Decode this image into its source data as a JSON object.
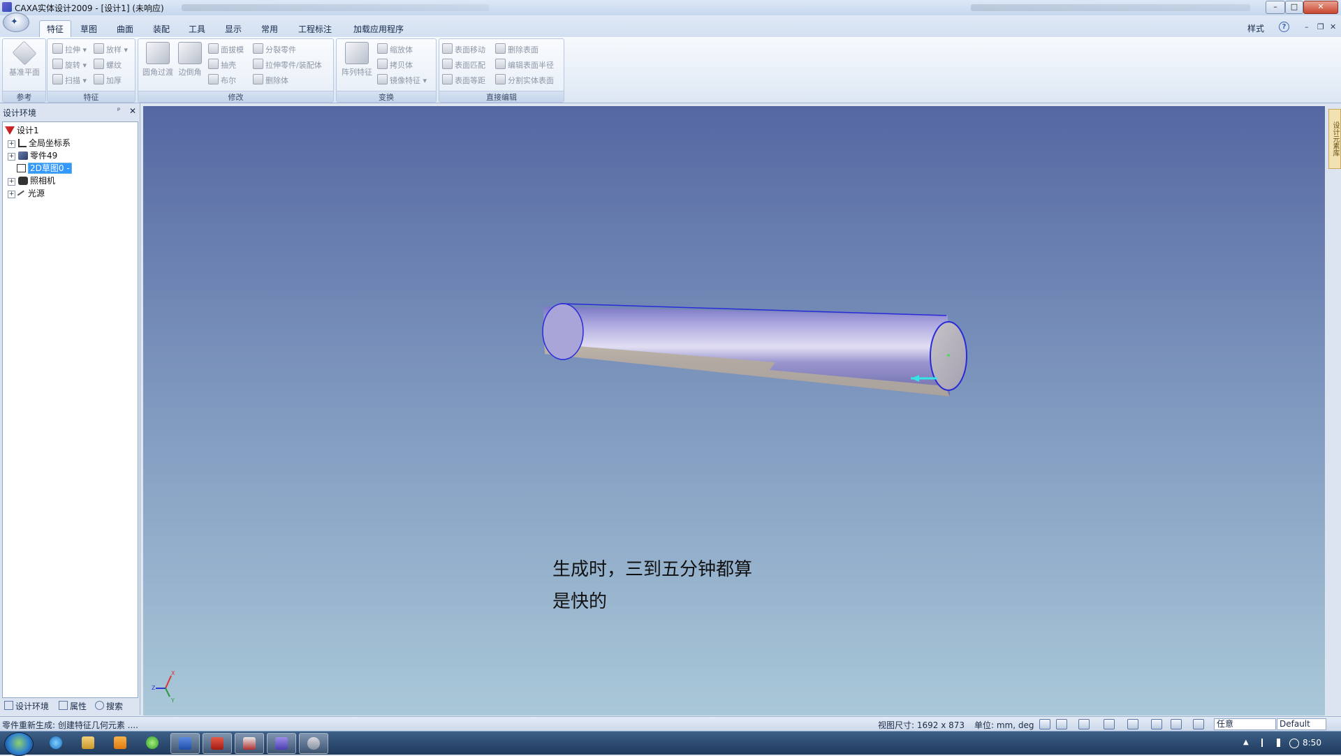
{
  "window": {
    "title": "CAXA实体设计2009 - [设计1] (未响应)",
    "minimize": "–",
    "maximize": "□",
    "close": "✕"
  },
  "ribbon": {
    "tabs": [
      "特征",
      "草图",
      "曲面",
      "装配",
      "工具",
      "显示",
      "常用",
      "工程标注",
      "加载应用程序"
    ],
    "active_tab": "特征",
    "style_label": "样式",
    "mdi_min": "–",
    "mdi_restore": "❐",
    "mdi_close": "✕",
    "groups": {
      "reference": {
        "title": "参考",
        "plane": "基准平面"
      },
      "feature": {
        "title": "特征",
        "extrude": "拉伸",
        "loft": "放样",
        "revolve": "旋转",
        "thread": "螺纹",
        "sweep": "扫描",
        "thicken": "加厚"
      },
      "modify": {
        "title": "修改",
        "fillet": "圆角过渡",
        "chamfer": "边倒角",
        "draft": "面拔模",
        "split_part": "分裂零件",
        "shell": "抽壳",
        "extrude_to_part": "拉伸零件/装配体",
        "boolean": "布尔",
        "delete_body": "删除体"
      },
      "transform": {
        "title": "变换",
        "pattern": "阵列特征",
        "scale": "缩放体",
        "copy": "拷贝体",
        "mirror": "镜像特征"
      },
      "direct_edit": {
        "title": "直接编辑",
        "move_face": "表面移动",
        "delete_face": "删除表面",
        "match_face": "表面匹配",
        "edit_radius": "编辑表面半径",
        "offset_face": "表面等距",
        "split_solid_face": "分割实体表面"
      }
    }
  },
  "design_panel": {
    "title": "设计环境",
    "pin": "ᵖ",
    "close": "✕",
    "tree": [
      {
        "label": "设计1",
        "expander": ""
      },
      {
        "label": "全局坐标系",
        "expander": "+"
      },
      {
        "label": "零件49",
        "expander": "+"
      },
      {
        "label": "2D草图0 -",
        "expander": "",
        "selected": true
      },
      {
        "label": "照相机",
        "expander": "+"
      },
      {
        "label": "光源",
        "expander": "+"
      }
    ],
    "tabs": [
      "设计环境",
      "属性",
      "搜索"
    ]
  },
  "viewport": {
    "caption_line1": "生成时，三到五分钟都算",
    "caption_line2": "是快的",
    "axis_x": "X",
    "axis_y": "Y",
    "axis_z": "Z",
    "side_tab": "设计元素库"
  },
  "statusbar": {
    "message": "零件重新生成: 创建特征几何元素 ....",
    "view_size": "视图尺寸: 1692 x 873",
    "units": "单位: mm, deg",
    "select_mode": "任意",
    "style": "Default"
  },
  "taskbar": {
    "clock": "8:50"
  },
  "colors": {
    "viewport_top": "#5567a2",
    "viewport_bottom": "#a9c8d8",
    "selection": "#3399ff",
    "cylinder_edge": "#2a2ad8",
    "arrow": "#35e6e6"
  }
}
